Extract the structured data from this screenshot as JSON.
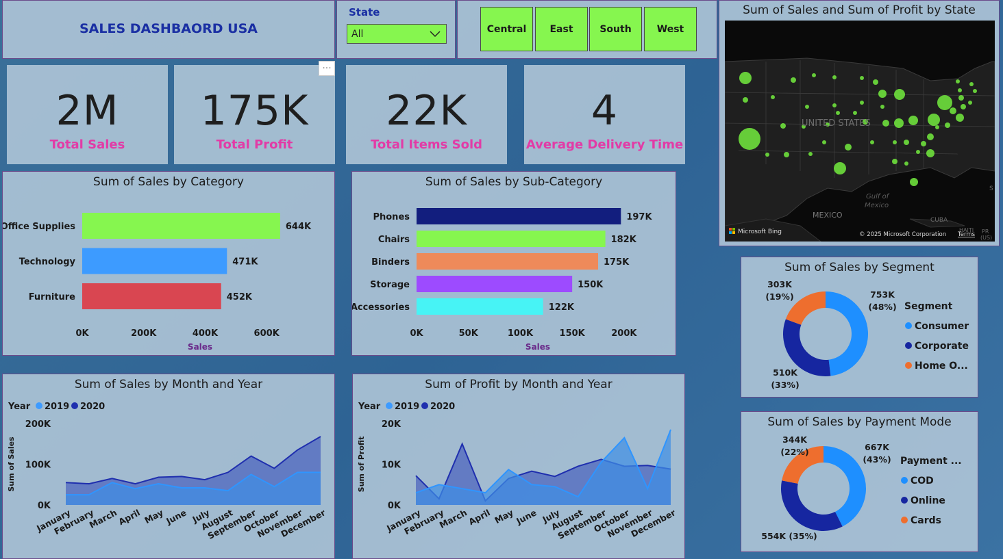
{
  "header": {
    "title": "SALES DASHBAORD USA"
  },
  "state_filter": {
    "label": "State",
    "value": "All"
  },
  "regions": [
    "Central",
    "East",
    "South",
    "West"
  ],
  "kpis": [
    {
      "value": "2M",
      "label": "Total Sales"
    },
    {
      "value": "175K",
      "label": "Total Profit"
    },
    {
      "value": "22K",
      "label": "Total Items Sold"
    },
    {
      "value": "4",
      "label": "Average Delivery Time"
    }
  ],
  "more_options": "···",
  "map": {
    "title": "Sum of Sales and Sum of Profit by State",
    "labels": {
      "country": "UNITED STATES",
      "mexico": "MEXICO",
      "gulf1": "Gulf of",
      "gulf2": "Mexico",
      "cuba": "CUBA",
      "haiti": "HAITI",
      "pr1": "PR",
      "pr2": "(US)",
      "s": "S"
    },
    "bing": "Microsoft Bing",
    "copyright": "© 2025 Microsoft Corporation",
    "terms": "Terms"
  },
  "colors": {
    "green": "#86f64f",
    "blue": "#3d9bff",
    "red": "#d94651",
    "navy": "#121e7e",
    "orange": "#ee8a5a",
    "purple": "#9d4bff",
    "cyan": "#47f3f5",
    "area2019": "#3d9bff",
    "area2020": "#1f2fae",
    "pink": "#e23ba6"
  },
  "chart_data": [
    {
      "type": "bar",
      "title": "Sum of Sales by Category",
      "categories": [
        "Office Supplies",
        "Technology",
        "Furniture"
      ],
      "values": [
        644,
        471,
        452
      ],
      "value_labels": [
        "644K",
        "471K",
        "452K"
      ],
      "colors": [
        "#86f64f",
        "#3d9bff",
        "#d94651"
      ],
      "xticks": [
        "0K",
        "200K",
        "400K",
        "600K"
      ],
      "xtick_values": [
        0,
        200,
        400,
        600
      ],
      "xlabel": "Sales",
      "xlim": [
        0,
        700
      ]
    },
    {
      "type": "bar",
      "title": "Sum of Sales by Sub-Category",
      "categories": [
        "Phones",
        "Chairs",
        "Binders",
        "Storage",
        "Accessories"
      ],
      "values": [
        197,
        182,
        175,
        150,
        122
      ],
      "value_labels": [
        "197K",
        "182K",
        "175K",
        "150K",
        "122K"
      ],
      "colors": [
        "#121e7e",
        "#86f64f",
        "#ee8a5a",
        "#9d4bff",
        "#47f3f5"
      ],
      "xticks": [
        "0K",
        "50K",
        "100K",
        "150K",
        "200K"
      ],
      "xtick_values": [
        0,
        50,
        100,
        150,
        200
      ],
      "xlabel": "Sales",
      "xlim": [
        0,
        210
      ]
    },
    {
      "type": "area",
      "title": "Sum of Sales by Month and Year",
      "legend_title": "Year",
      "categories": [
        "January",
        "February",
        "March",
        "April",
        "May",
        "June",
        "July",
        "August",
        "September",
        "October",
        "November",
        "December"
      ],
      "series": [
        {
          "name": "2019",
          "values": [
            25,
            25,
            55,
            40,
            52,
            42,
            42,
            35,
            75,
            45,
            80,
            80
          ]
        },
        {
          "name": "2020",
          "values": [
            55,
            52,
            65,
            52,
            68,
            70,
            62,
            80,
            120,
            90,
            135,
            168
          ]
        }
      ],
      "yticks": [
        "0K",
        "100K",
        "200K"
      ],
      "ytick_values": [
        0,
        100,
        200
      ],
      "ylabel": "Sum of Sales",
      "ylim": [
        0,
        200
      ]
    },
    {
      "type": "area",
      "title": "Sum of Profit by Month and Year",
      "legend_title": "Year",
      "categories": [
        "January",
        "February",
        "March",
        "April",
        "May",
        "June",
        "July",
        "August",
        "September",
        "October",
        "November",
        "December"
      ],
      "series": [
        {
          "name": "2019",
          "values": [
            3.0,
            5.0,
            4.0,
            3.0,
            8.7,
            5.0,
            4.5,
            2.0,
            10.5,
            16.5,
            4.0,
            18.5
          ]
        },
        {
          "name": "2020",
          "values": [
            7.2,
            1.5,
            15.0,
            1.0,
            6.5,
            8.3,
            7.0,
            9.5,
            11.2,
            9.5,
            9.7,
            8.8
          ]
        }
      ],
      "yticks": [
        "0K",
        "10K",
        "20K"
      ],
      "ytick_values": [
        0,
        10,
        20
      ],
      "ylabel": "Sum of Profit",
      "ylim": [
        0,
        20
      ]
    },
    {
      "type": "pie",
      "title": "Sum of Sales by Segment",
      "legend_title": "Segment",
      "categories": [
        "Consumer",
        "Corporate",
        "Home O..."
      ],
      "values": [
        753,
        510,
        303
      ],
      "labels": [
        [
          "753K",
          "(48%)"
        ],
        [
          "510K",
          "(33%)"
        ],
        [
          "303K",
          "(19%)"
        ]
      ],
      "colors": [
        "#1e8fff",
        "#1626a0",
        "#ee6e2e"
      ]
    },
    {
      "type": "pie",
      "title": "Sum of Sales by Payment Mode",
      "legend_title": "Payment ...",
      "categories": [
        "COD",
        "Online",
        "Cards"
      ],
      "values": [
        667,
        554,
        344
      ],
      "labels": [
        [
          "667K",
          "(43%)"
        ],
        [
          "554K (35%)",
          ""
        ],
        [
          "344K",
          "(22%)"
        ]
      ],
      "colors": [
        "#1e8fff",
        "#1626a0",
        "#ee6e2e"
      ]
    }
  ]
}
